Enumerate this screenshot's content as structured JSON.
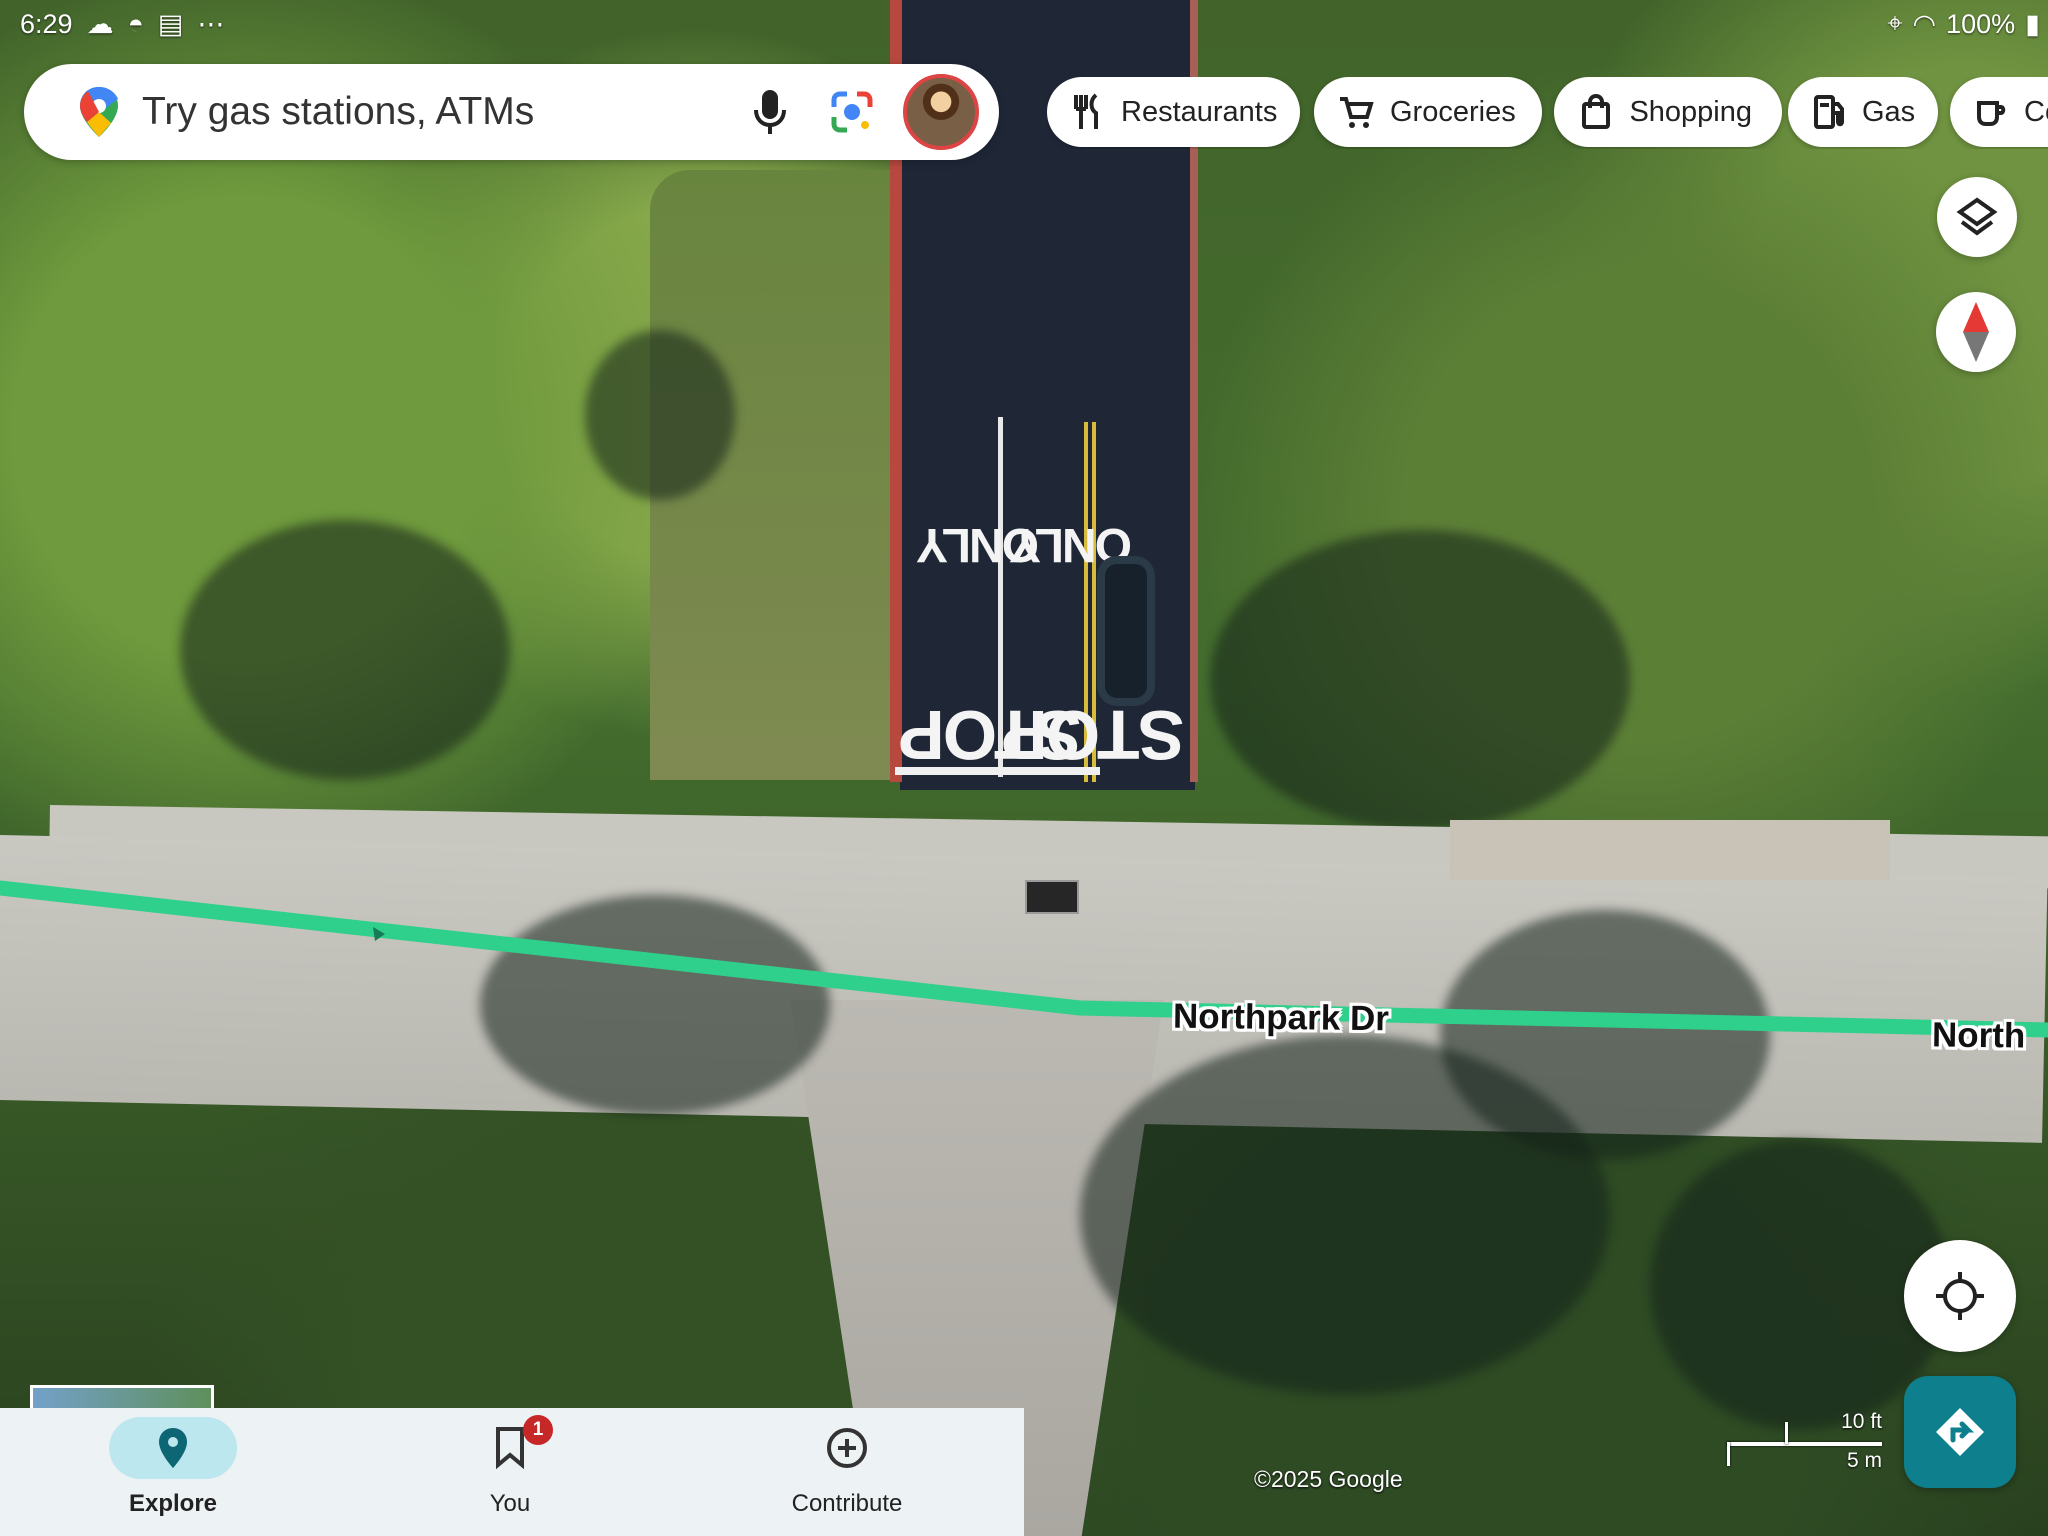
{
  "status_bar": {
    "time": "6:29",
    "battery": "100%",
    "icons_left": [
      "cloud-icon",
      "incognito-icon",
      "pdf-icon",
      "more-icon"
    ],
    "icons_right": [
      "location-icon",
      "wifi-icon",
      "battery-icon"
    ]
  },
  "search": {
    "placeholder": "Try gas stations, ATMs",
    "value": "",
    "icons": [
      "maps-pin-icon",
      "mic-icon",
      "lens-icon",
      "avatar"
    ]
  },
  "chips": [
    {
      "label": "Restaurants",
      "icon": "utensils-icon"
    },
    {
      "label": "Groceries",
      "icon": "cart-icon"
    },
    {
      "label": "Shopping",
      "icon": "bag-icon"
    },
    {
      "label": "Gas",
      "icon": "gas-icon"
    },
    {
      "label": "Co",
      "icon": "coffee-icon"
    }
  ],
  "map": {
    "type": "satellite",
    "road_labels": [
      {
        "text": "Northpark Dr"
      },
      {
        "text": "North"
      }
    ],
    "pavement_markings": {
      "stop": "STOP",
      "only": "ONLY"
    },
    "route_color": "#2fd08c",
    "copyright": "©2025 Google",
    "scale": {
      "imperial": "10 ft",
      "metric": "5 m"
    }
  },
  "controls": [
    "layers-icon",
    "compass-icon",
    "my-location-icon",
    "directions-icon"
  ],
  "bottom_nav": {
    "items": [
      {
        "label": "Explore",
        "icon": "explore-pin-icon",
        "active": true
      },
      {
        "label": "You",
        "icon": "bookmark-icon",
        "badge": "1"
      },
      {
        "label": "Contribute",
        "icon": "add-circle-icon"
      }
    ]
  },
  "colors": {
    "route": "#2fd08c",
    "directions_button": "#0d7f8d",
    "active_nav": "#bde7ef",
    "badge": "#c62828"
  }
}
